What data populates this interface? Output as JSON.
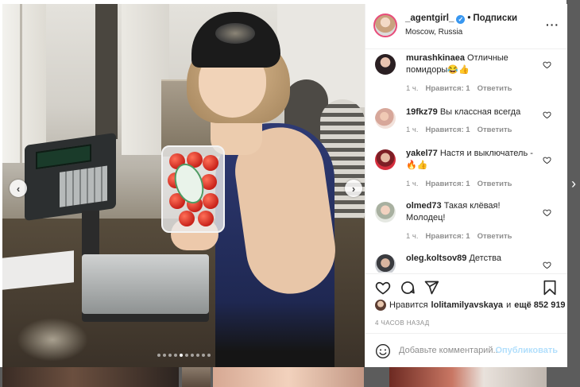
{
  "post": {
    "username": "_agentgirl_",
    "follow_label": "Подписки",
    "location": "Moscow, Russia",
    "time_ago": "4 ЧАСОВ НАЗАД"
  },
  "comments": [
    {
      "user": "murashkinaea",
      "text": "Отличные помидоры😂👍",
      "time": "1 ч.",
      "likes_label": "Нравится: 1",
      "reply_label": "Ответить"
    },
    {
      "user": "19fkz79",
      "text": "Вы классная всегда",
      "time": "1 ч.",
      "likes_label": "Нравится: 1",
      "reply_label": "Ответить"
    },
    {
      "user": "yakel77",
      "text": "Настя и выключатель - 🔥👍",
      "time": "1 ч.",
      "likes_label": "Нравится: 1",
      "reply_label": "Ответить"
    },
    {
      "user": "olmed73",
      "text": "Такая клёвая! Молодец!",
      "time": "1 ч.",
      "likes_label": "Нравится: 1",
      "reply_label": "Ответить"
    },
    {
      "user": "oleg.koltsov89",
      "text": "Детства"
    }
  ],
  "likes": {
    "prefix": "Нравится",
    "user": "lolitamilyavskaya",
    "conjunction": "и",
    "others": "ещё 852 919"
  },
  "add_comment": {
    "placeholder": "Добавьте комментарий...",
    "post_label": "Опубликовать"
  },
  "carousel": {
    "total": 10,
    "active_index": 4
  },
  "colors": {
    "verified": "#3897f0",
    "post_button_disabled": "#b2dffc",
    "story_ring": "#e84c7a",
    "backdrop": "#5c5c5c"
  },
  "icons": [
    "verified-badge-icon",
    "more-options-icon",
    "heart-icon",
    "comment-icon",
    "share-icon",
    "bookmark-icon",
    "emoji-icon",
    "chevron-left-icon",
    "chevron-right-icon"
  ]
}
